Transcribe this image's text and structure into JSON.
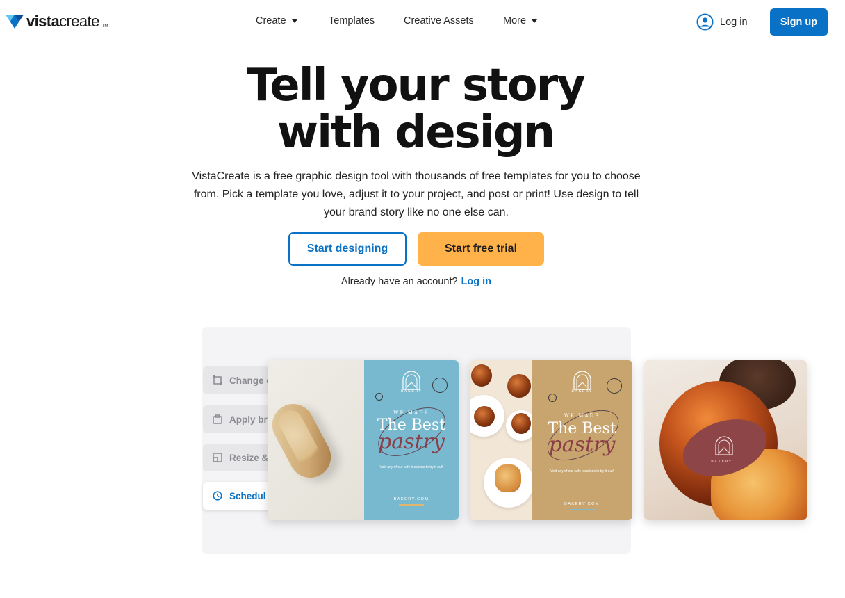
{
  "brand": {
    "name_bold": "vista",
    "name_light": "create",
    "tm": "TM"
  },
  "nav": {
    "create": "Create",
    "templates": "Templates",
    "creative_assets": "Creative Assets",
    "more": "More"
  },
  "header": {
    "login": "Log in",
    "signup": "Sign up"
  },
  "hero": {
    "title_line1": "Tell your story",
    "title_line2": "with design",
    "description": "VistaCreate is a free graphic design tool with thousands of free templates for you to choose from. Pick a template you love, adjust it to your project, and post or print! Use design to tell your brand story like no one else can.",
    "btn_start_designing": "Start designing",
    "btn_free_trial": "Start free trial",
    "account_text": "Already have an account?",
    "account_login": "Log in"
  },
  "showcase": {
    "side_items": [
      {
        "label": "Change c",
        "icon": "change-icon",
        "active": false
      },
      {
        "label": "Apply br",
        "icon": "brand-kit-icon",
        "active": false
      },
      {
        "label": "Resize &",
        "icon": "resize-icon",
        "active": false
      },
      {
        "label": "Schedul",
        "icon": "clock-icon",
        "active": true
      }
    ],
    "poster": {
      "brand": "BAKERY",
      "we_made": "WE MADE",
      "best": "The Best",
      "pastry": "pastry",
      "visit": "Visit any of our cafe locations to try it out!",
      "site": "BAKERY.COM"
    },
    "card3_brand": "BAKERY"
  },
  "colors": {
    "primary_blue": "#0a72c6",
    "orange": "#ffb24a",
    "poster_blue": "#78b9cf",
    "poster_tan": "#c8a56e",
    "blob": "#8e4548"
  }
}
